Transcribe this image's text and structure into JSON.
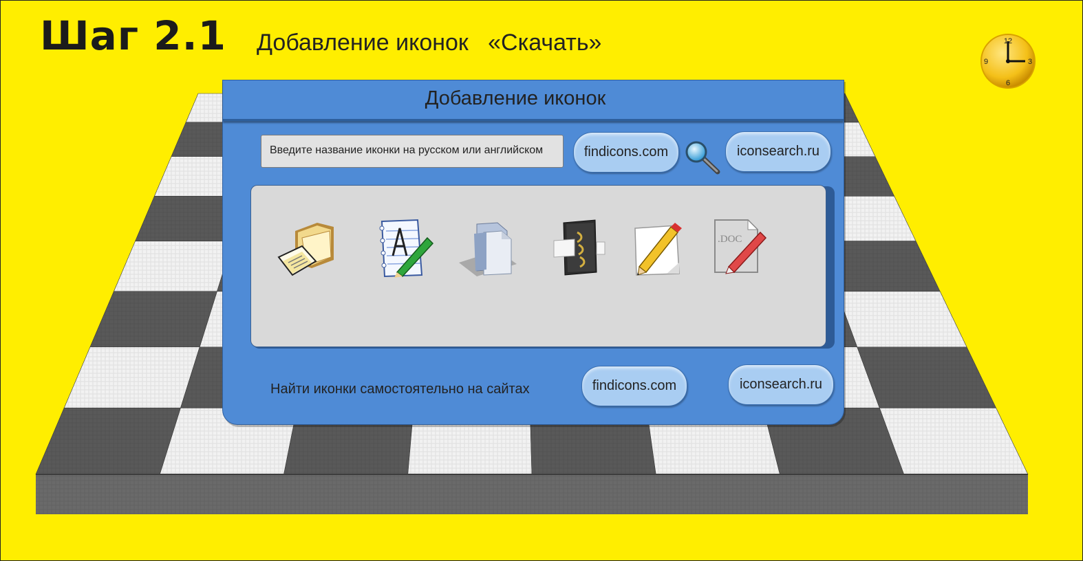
{
  "header": {
    "step_title": "Шаг 2.1",
    "subtitle": "Добавление иконок   «Скачать»"
  },
  "clock": {
    "icon": "clock-icon",
    "numbers": [
      "12",
      "3",
      "6",
      "9"
    ],
    "face_color": "#f5c21a"
  },
  "dialog": {
    "title": "Добавление иконок",
    "search_placeholder": "Введите название иконки на русском или английском",
    "search_icon": "magnifier-icon",
    "top_links": [
      "findicons.com",
      "iconsearch.ru"
    ],
    "gallery_icons": [
      "folder-documents-icon",
      "text-editor-icon",
      "documents-icon",
      "binder-icon",
      "pencil-note-icon",
      "doc-file-icon"
    ],
    "doc_label": ".DOC",
    "footer_label": "Найти иконки самостоятельно на сайтах",
    "bottom_links": [
      "findicons.com",
      "iconsearch.ru"
    ]
  },
  "colors": {
    "background": "#ffee00",
    "dialog": "#4f8bd6",
    "pill": "#a9cdf2",
    "gallery": "#d9d9d9"
  }
}
